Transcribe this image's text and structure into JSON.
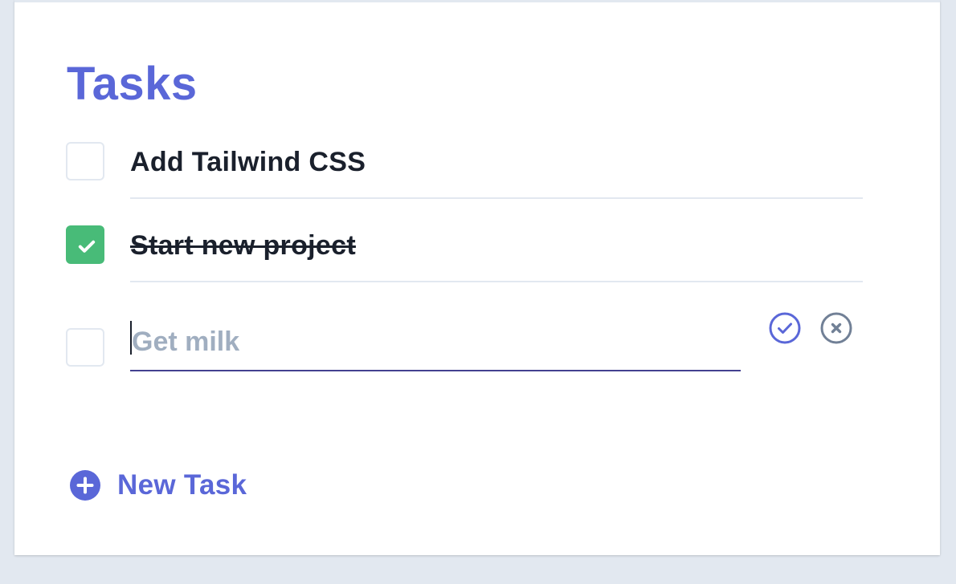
{
  "header": {
    "title": "Tasks"
  },
  "tasks": [
    {
      "label": "Add Tailwind CSS",
      "done": false
    },
    {
      "label": "Start new project",
      "done": true
    }
  ],
  "new_task_input": {
    "value": "",
    "placeholder": "Get milk"
  },
  "actions": {
    "new_task_label": "New Task"
  },
  "icons": {
    "checkmark": "check-icon",
    "confirm": "check-circle-icon",
    "cancel": "x-circle-icon",
    "add": "plus-circle-icon"
  },
  "colors": {
    "accent": "#5a67d8",
    "done": "#48bb78",
    "text": "#1a202c",
    "muted": "#718096",
    "border": "#e2e8f0",
    "placeholder": "#a0aec0",
    "input_underline": "#434190",
    "background": "#e2e8f0"
  }
}
